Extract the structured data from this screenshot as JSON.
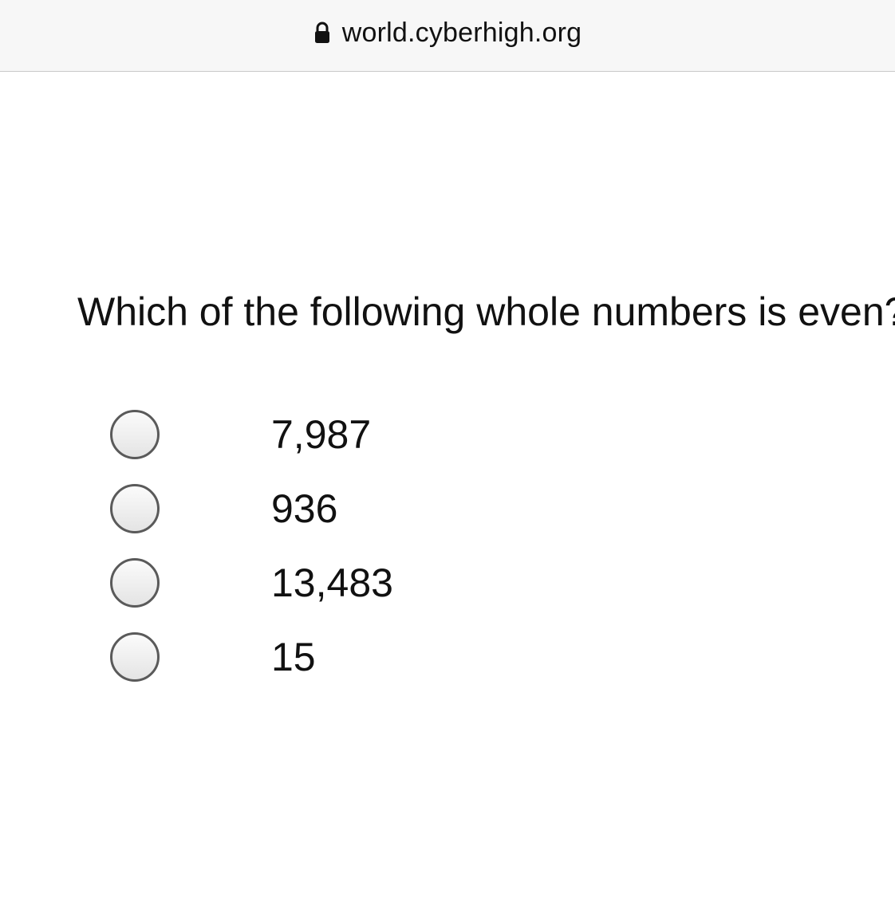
{
  "browser": {
    "url": "world.cyberhigh.org"
  },
  "question": {
    "text": "Which of the following whole numbers is even?"
  },
  "options": [
    {
      "label": "7,987"
    },
    {
      "label": "936"
    },
    {
      "label": "13,483"
    },
    {
      "label": "15"
    }
  ]
}
